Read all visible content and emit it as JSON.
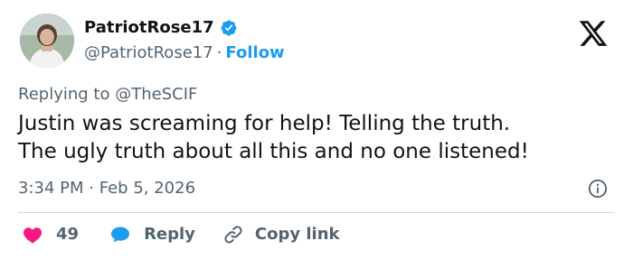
{
  "user": {
    "display_name": "PatriotRose17",
    "handle": "@PatriotRose17",
    "separator": "·",
    "follow_label": "Follow",
    "verified": true
  },
  "reply": {
    "prefix": "Replying to",
    "handle": "@TheSCIF"
  },
  "post": {
    "lines": [
      "Justin was screaming for help! Telling the truth.",
      "The ugly truth about all this and no one listened!"
    ]
  },
  "meta": {
    "time": "3:34 PM",
    "separator": "·",
    "date": "Feb 5, 2026"
  },
  "actions": {
    "like_count": "49",
    "reply_label": "Reply",
    "copy_label": "Copy link"
  },
  "icons": {
    "brand": "x-logo-icon",
    "verified": "verified-badge-icon",
    "info": "info-icon",
    "like": "heart-icon",
    "reply": "comment-bubble-icon",
    "copy": "link-icon"
  },
  "colors": {
    "accent": "#1d9bf0",
    "like": "#f91880",
    "text": "#0f1419",
    "muted": "#536471",
    "divider": "#cfd9de"
  }
}
